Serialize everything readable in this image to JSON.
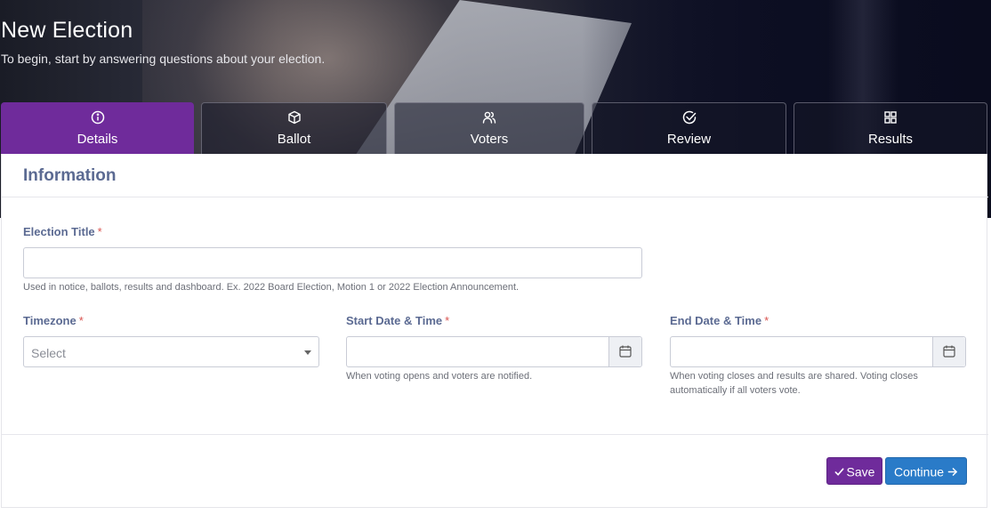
{
  "header": {
    "title": "New Election",
    "subtitle": "To begin, start by answering questions about your election."
  },
  "tabs": [
    {
      "label": "Details",
      "icon": "info-icon",
      "active": true
    },
    {
      "label": "Ballot",
      "icon": "cube-icon",
      "active": false
    },
    {
      "label": "Voters",
      "icon": "users-icon",
      "active": false
    },
    {
      "label": "Review",
      "icon": "check-circle-icon",
      "active": false
    },
    {
      "label": "Results",
      "icon": "grid-icon",
      "active": false
    }
  ],
  "form": {
    "section_title": "Information",
    "required_marker": "*",
    "election_title": {
      "label": "Election Title",
      "value": "",
      "help": "Used in notice, ballots, results and dashboard. Ex. 2022 Board Election, Motion 1 or 2022 Election Announcement."
    },
    "timezone": {
      "label": "Timezone",
      "placeholder": "Select"
    },
    "start": {
      "label": "Start Date & Time",
      "value": "",
      "help": "When voting opens and voters are notified."
    },
    "end": {
      "label": "End Date & Time",
      "value": "",
      "help_line1": "When voting closes and results are shared. Voting closes",
      "help_line2": "automatically if all voters vote."
    }
  },
  "actions": {
    "save_label": "Save",
    "continue_label": "Continue",
    "save_icon": "check-icon",
    "continue_icon": "arrow-right-icon"
  },
  "colors": {
    "accent_purple": "#6f2b9b",
    "primary_blue": "#2a7bc8",
    "label_color": "#5b6a92",
    "required_red": "#d9534f"
  }
}
